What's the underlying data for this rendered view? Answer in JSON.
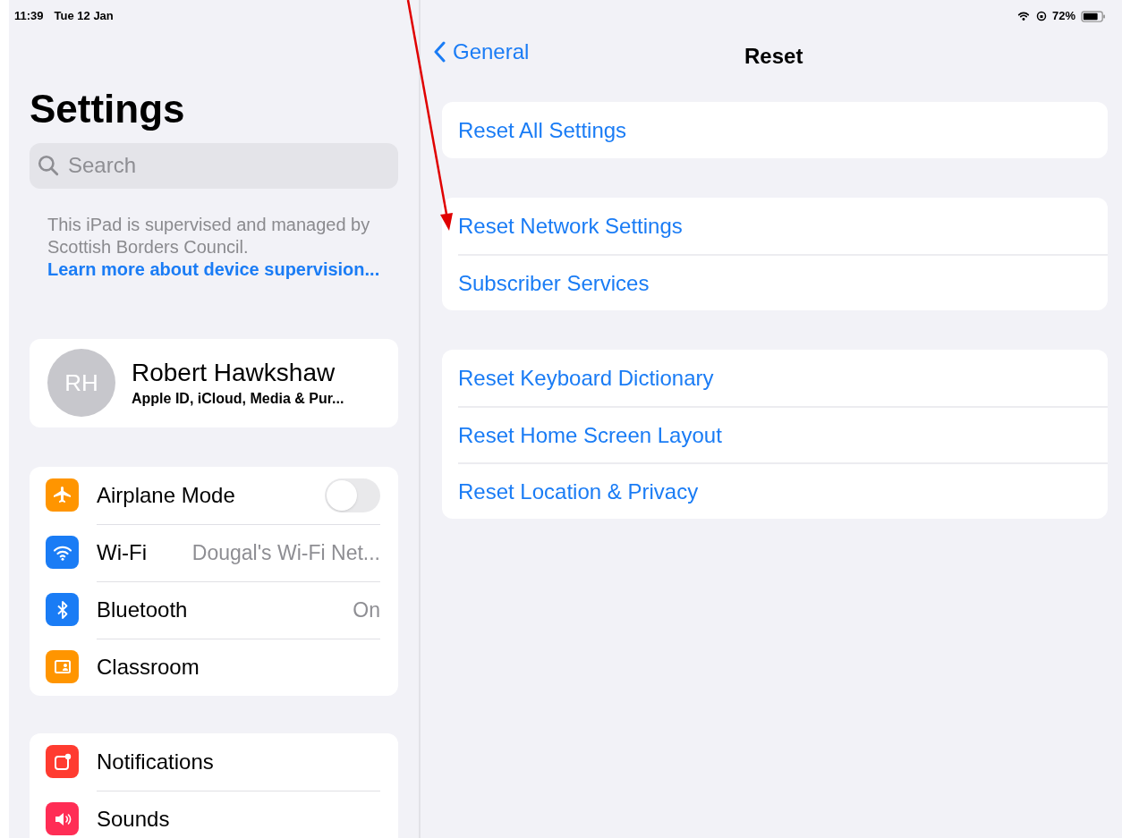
{
  "status_bar": {
    "time": "11:39",
    "date": "Tue 12 Jan",
    "battery": "72%"
  },
  "sidebar": {
    "title": "Settings",
    "search": {
      "placeholder": "Search"
    },
    "supervision_note": {
      "text": "This iPad is supervised and managed by Scottish Borders Council.",
      "link": "Learn more about device supervision..."
    },
    "profile": {
      "initials": "RH",
      "name": "Robert Hawkshaw",
      "subtitle": "Apple ID, iCloud, Media & Pur..."
    },
    "groups": [
      [
        {
          "label": "Airplane Mode",
          "kind": "toggle",
          "on": false,
          "color": "#ff9500"
        },
        {
          "label": "Wi-Fi",
          "kind": "value",
          "value": "Dougal's Wi-Fi Net...",
          "color": "#1a7cf5"
        },
        {
          "label": "Bluetooth",
          "kind": "value",
          "value": "On",
          "color": "#1a7cf5"
        },
        {
          "label": "Classroom",
          "kind": "plain",
          "color": "#ff9500"
        }
      ],
      [
        {
          "label": "Notifications",
          "kind": "plain",
          "color": "#ff3b30"
        },
        {
          "label": "Sounds",
          "kind": "plain",
          "color": "#ff2d55"
        }
      ]
    ]
  },
  "detail": {
    "back": "General",
    "title": "Reset",
    "groups": [
      [
        "Reset All Settings"
      ],
      [
        "Reset Network Settings",
        "Subscriber Services"
      ],
      [
        "Reset Keyboard Dictionary",
        "Reset Home Screen Layout",
        "Reset Location & Privacy"
      ]
    ]
  }
}
